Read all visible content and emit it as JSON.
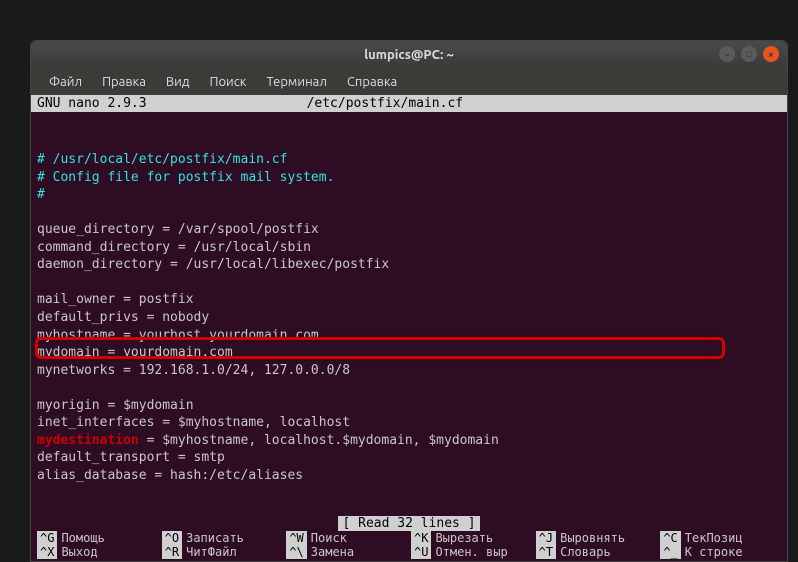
{
  "window": {
    "title": "lumpics@PC: ~"
  },
  "menubar": {
    "items": [
      "Файл",
      "Правка",
      "Вид",
      "Поиск",
      "Терминал",
      "Справка"
    ]
  },
  "nano": {
    "app": "  GNU nano 2.9.3",
    "file": "/etc/postfix/main.cf",
    "status": "[ Read 32 lines ]"
  },
  "content": {
    "c1": "# /usr/local/etc/postfix/main.cf",
    "c2": "# Config file for postfix mail system.",
    "c3": "#",
    "l1": "queue_directory = /var/spool/postfix",
    "l2": "command_directory = /usr/local/sbin",
    "l3": "daemon_directory = /usr/local/libexec/postfix",
    "l4": "mail_owner = postfix",
    "l5": "default_privs = nobody",
    "l6": "myhostname = yourhost.yourdomain.com",
    "l7": "mydomain = yourdomain.com",
    "l8": "mynetworks = 192.168.1.0/24, 127.0.0.0/8",
    "l9": "myorigin = $mydomain",
    "l10": "inet_interfaces = $myhostname, localhost",
    "l11_k": "mydestination",
    "l11_v": " = $myhostname, localhost.$mydomain, $mydomain",
    "l12": "default_transport = smtp",
    "l13": "alias_database = hash:/etc/aliases"
  },
  "shortcuts": {
    "k1": "^G",
    "t1": "Помощь",
    "k2": "^O",
    "t2": "Записать",
    "k3": "^W",
    "t3": "Поиск",
    "k4": "^K",
    "t4": "Вырезать",
    "k5": "^J",
    "t5": "Выровнять",
    "k6": "^C",
    "t6": "ТекПозиц",
    "k7": "^X",
    "t7": "Выход",
    "k8": "^R",
    "t8": "ЧитФайл",
    "k9": "^\\",
    "t9": "Замена",
    "k10": "^U",
    "t10": "Отмен. выр",
    "k11": "^T",
    "t11": "Словарь",
    "k12": "^_",
    "t12": "К строке"
  }
}
